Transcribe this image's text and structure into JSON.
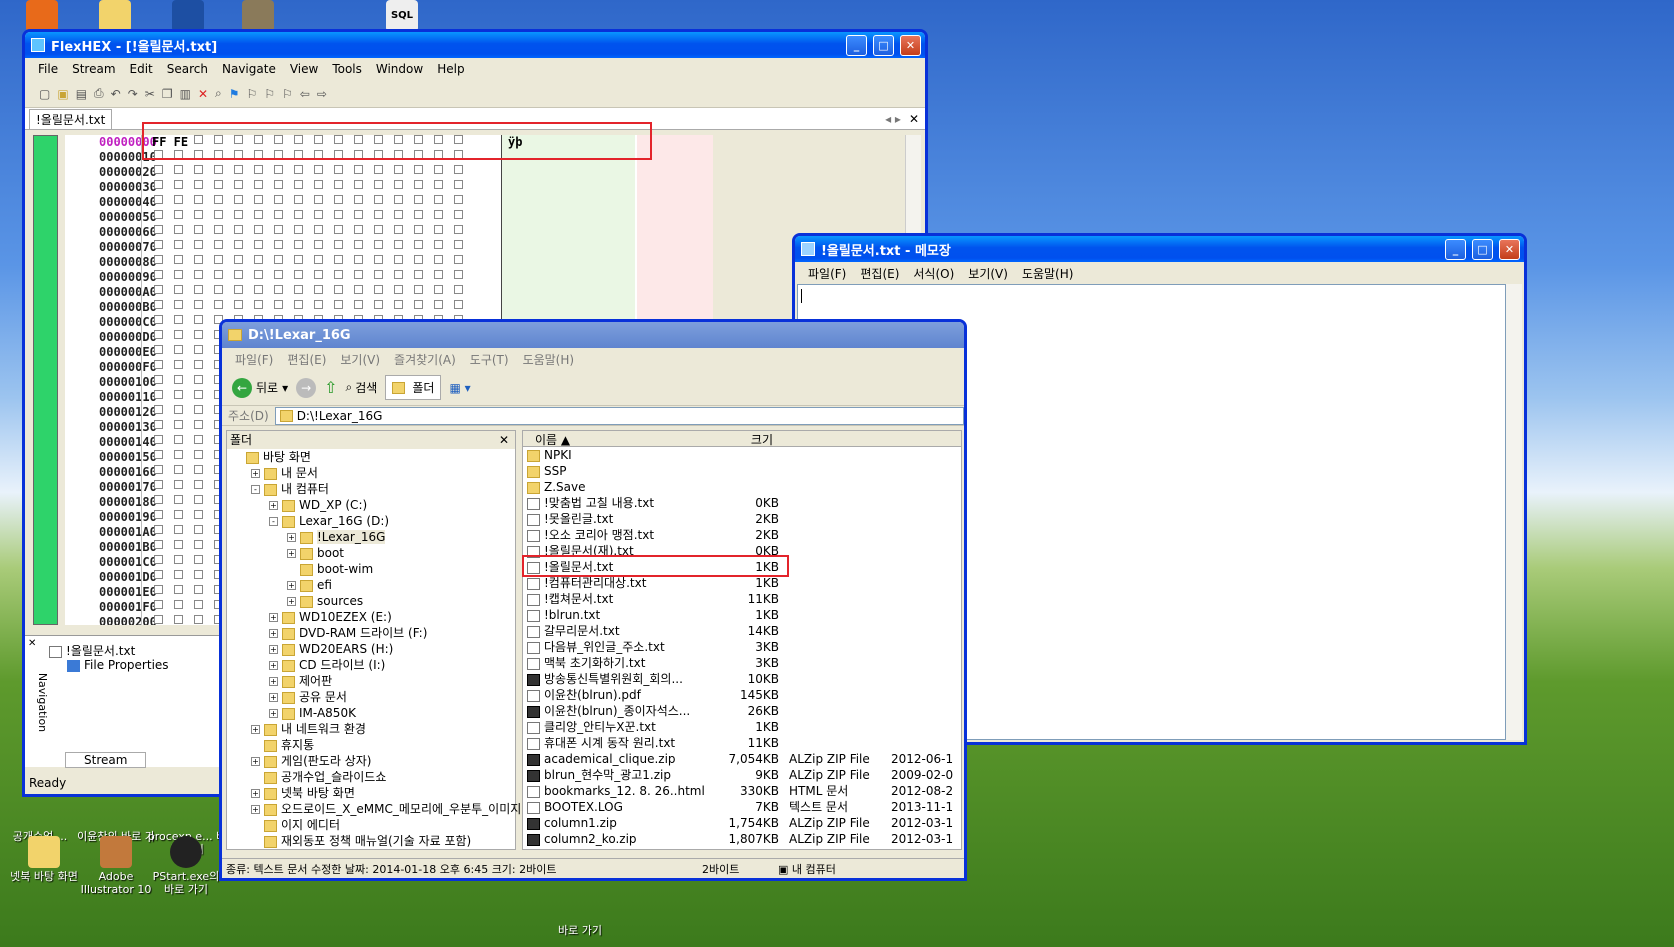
{
  "desktop": {
    "icons_top": [
      "",
      "",
      "",
      "",
      "SQL",
      "",
      "",
      ""
    ],
    "icons_left_labels": [
      "공개수업....",
      "이윤찬의 바로 가기",
      "procexp.e... 바로 가기",
      "넷북 바탕 화면",
      "Adobe Illustrator 10",
      "PStart.exe의 바로 가기",
      "바로 가기"
    ]
  },
  "hex": {
    "title": "FlexHEX - [!올릴문서.txt]",
    "menu": [
      "File",
      "Stream",
      "Edit",
      "Search",
      "Navigate",
      "View",
      "Tools",
      "Window",
      "Help"
    ],
    "tab": "!올릴문서.txt",
    "first_bytes": "FF FE",
    "first_char": "ÿþ",
    "offsets": [
      "00000000",
      "00000010",
      "00000020",
      "00000030",
      "00000040",
      "00000050",
      "00000060",
      "00000070",
      "00000080",
      "00000090",
      "000000A0",
      "000000B0",
      "000000C0",
      "000000D0",
      "000000E0",
      "000000F0",
      "00000100",
      "00000110",
      "00000120",
      "00000130",
      "00000140",
      "00000150",
      "00000160",
      "00000170",
      "00000180",
      "00000190",
      "000001A0",
      "000001B0",
      "000001C0",
      "000001D0",
      "000001E0",
      "000001F0",
      "00000200"
    ],
    "nav": {
      "file": "!올릴문서.txt",
      "props": "File Properties",
      "label": "Navigation",
      "stream_tab": "Stream"
    },
    "status": "Ready"
  },
  "notepad": {
    "title": "!올릴문서.txt - 메모장",
    "menu": [
      "파일(F)",
      "편집(E)",
      "서식(O)",
      "보기(V)",
      "도움말(H)"
    ]
  },
  "explorer": {
    "title": "D:\\!Lexar_16G",
    "menu": [
      "파일(F)",
      "편집(E)",
      "보기(V)",
      "즐겨찾기(A)",
      "도구(T)",
      "도움말(H)"
    ],
    "toolbar": {
      "back": "뒤로",
      "search": "검색",
      "folders": "폴더"
    },
    "address_label": "주소(D)",
    "address": "D:\\!Lexar_16G",
    "folders_pane": "폴더",
    "tree": [
      {
        "d": 0,
        "e": "",
        "t": "바탕 화면"
      },
      {
        "d": 1,
        "e": "+",
        "t": "내 문서"
      },
      {
        "d": 1,
        "e": "-",
        "t": "내 컴퓨터"
      },
      {
        "d": 2,
        "e": "+",
        "t": "WD_XP (C:)"
      },
      {
        "d": 2,
        "e": "-",
        "t": "Lexar_16G (D:)"
      },
      {
        "d": 3,
        "e": "+",
        "t": "!Lexar_16G"
      },
      {
        "d": 3,
        "e": "+",
        "t": "boot"
      },
      {
        "d": 3,
        "e": "",
        "t": "boot-wim"
      },
      {
        "d": 3,
        "e": "+",
        "t": "efi"
      },
      {
        "d": 3,
        "e": "+",
        "t": "sources"
      },
      {
        "d": 2,
        "e": "+",
        "t": "WD10EZEX (E:)"
      },
      {
        "d": 2,
        "e": "+",
        "t": "DVD-RAM 드라이브 (F:)"
      },
      {
        "d": 2,
        "e": "+",
        "t": "WD20EARS (H:)"
      },
      {
        "d": 2,
        "e": "+",
        "t": "CD 드라이브 (I:)"
      },
      {
        "d": 2,
        "e": "+",
        "t": "제어판"
      },
      {
        "d": 2,
        "e": "+",
        "t": "공유 문서"
      },
      {
        "d": 2,
        "e": "+",
        "t": "IM-A850K"
      },
      {
        "d": 1,
        "e": "+",
        "t": "내 네트워크 환경"
      },
      {
        "d": 1,
        "e": "",
        "t": "휴지통"
      },
      {
        "d": 1,
        "e": "+",
        "t": "게임(판도라 상자)"
      },
      {
        "d": 1,
        "e": "",
        "t": "공개수업_슬라이드쇼"
      },
      {
        "d": 1,
        "e": "+",
        "t": "넷북 바탕 화면"
      },
      {
        "d": 1,
        "e": "+",
        "t": "오드로이드_X_eMMC_메모리에_우분투_이미지"
      },
      {
        "d": 1,
        "e": "",
        "t": "이지 에디터"
      },
      {
        "d": 1,
        "e": "",
        "t": "재외동포 정책 매뉴얼(기술 자료 포함)"
      }
    ],
    "cols": {
      "name": "이름",
      "size": "크기"
    },
    "files": [
      {
        "i": "folder",
        "n": "NPKI",
        "s": "",
        "ty": "",
        "dt": ""
      },
      {
        "i": "folder",
        "n": "SSP",
        "s": "",
        "ty": "",
        "dt": ""
      },
      {
        "i": "folder",
        "n": "Z.Save",
        "s": "",
        "ty": "",
        "dt": ""
      },
      {
        "i": "txt",
        "n": "!맞춤법 고칠 내용.txt",
        "s": "0KB",
        "ty": "",
        "dt": ""
      },
      {
        "i": "txt",
        "n": "!못올린글.txt",
        "s": "2KB",
        "ty": "",
        "dt": ""
      },
      {
        "i": "txt",
        "n": "!오소 코리아 맹점.txt",
        "s": "2KB",
        "ty": "",
        "dt": ""
      },
      {
        "i": "txt",
        "n": "!올릴문서(재).txt",
        "s": "0KB",
        "ty": "",
        "dt": ""
      },
      {
        "i": "txt",
        "n": "!올릴문서.txt",
        "s": "1KB",
        "ty": "",
        "dt": ""
      },
      {
        "i": "txt",
        "n": "!컴퓨터관리대상.txt",
        "s": "1KB",
        "ty": "",
        "dt": ""
      },
      {
        "i": "txt",
        "n": "!캡쳐문서.txt",
        "s": "11KB",
        "ty": "",
        "dt": ""
      },
      {
        "i": "txt",
        "n": "!blrun.txt",
        "s": "1KB",
        "ty": "",
        "dt": ""
      },
      {
        "i": "txt",
        "n": "갈무리문서.txt",
        "s": "14KB",
        "ty": "",
        "dt": ""
      },
      {
        "i": "txt",
        "n": "다음뷰_위인글_주소.txt",
        "s": "3KB",
        "ty": "",
        "dt": ""
      },
      {
        "i": "txt",
        "n": "맥북 초기화하기.txt",
        "s": "3KB",
        "ty": "",
        "dt": ""
      },
      {
        "i": "zip",
        "n": "방송통신특별위원회_회의...",
        "s": "10KB",
        "ty": "",
        "dt": ""
      },
      {
        "i": "txt",
        "n": "이윤찬(blrun).pdf",
        "s": "145KB",
        "ty": "",
        "dt": ""
      },
      {
        "i": "zip",
        "n": "이윤찬(blrun)_종이자석스...",
        "s": "26KB",
        "ty": "",
        "dt": ""
      },
      {
        "i": "txt",
        "n": "클리앙_안티누X꾼.txt",
        "s": "1KB",
        "ty": "",
        "dt": ""
      },
      {
        "i": "txt",
        "n": "휴대폰 시계 동작 원리.txt",
        "s": "11KB",
        "ty": "",
        "dt": ""
      },
      {
        "i": "zip",
        "n": "academical_clique.zip",
        "s": "7,054KB",
        "ty": "ALZip ZIP File",
        "dt": "2012-06-1"
      },
      {
        "i": "zip",
        "n": "blrun_현수막_광고1.zip",
        "s": "9KB",
        "ty": "ALZip ZIP File",
        "dt": "2009-02-0"
      },
      {
        "i": "txt",
        "n": "bookmarks_12. 8. 26..html",
        "s": "330KB",
        "ty": "HTML 문서",
        "dt": "2012-08-2"
      },
      {
        "i": "txt",
        "n": "BOOTEX.LOG",
        "s": "7KB",
        "ty": "텍스트 문서",
        "dt": "2013-11-1"
      },
      {
        "i": "zip",
        "n": "column1.zip",
        "s": "1,754KB",
        "ty": "ALZip ZIP File",
        "dt": "2012-03-1"
      },
      {
        "i": "zip",
        "n": "column2_ko.zip",
        "s": "1,807KB",
        "ty": "ALZip ZIP File",
        "dt": "2012-03-1"
      }
    ],
    "status": {
      "info": "종류: 텍스트 문서 수정한 날짜: 2014-01-18 오후 6:45 크기: 2바이트",
      "size": "2바이트",
      "location": "내 컴퓨터"
    }
  }
}
